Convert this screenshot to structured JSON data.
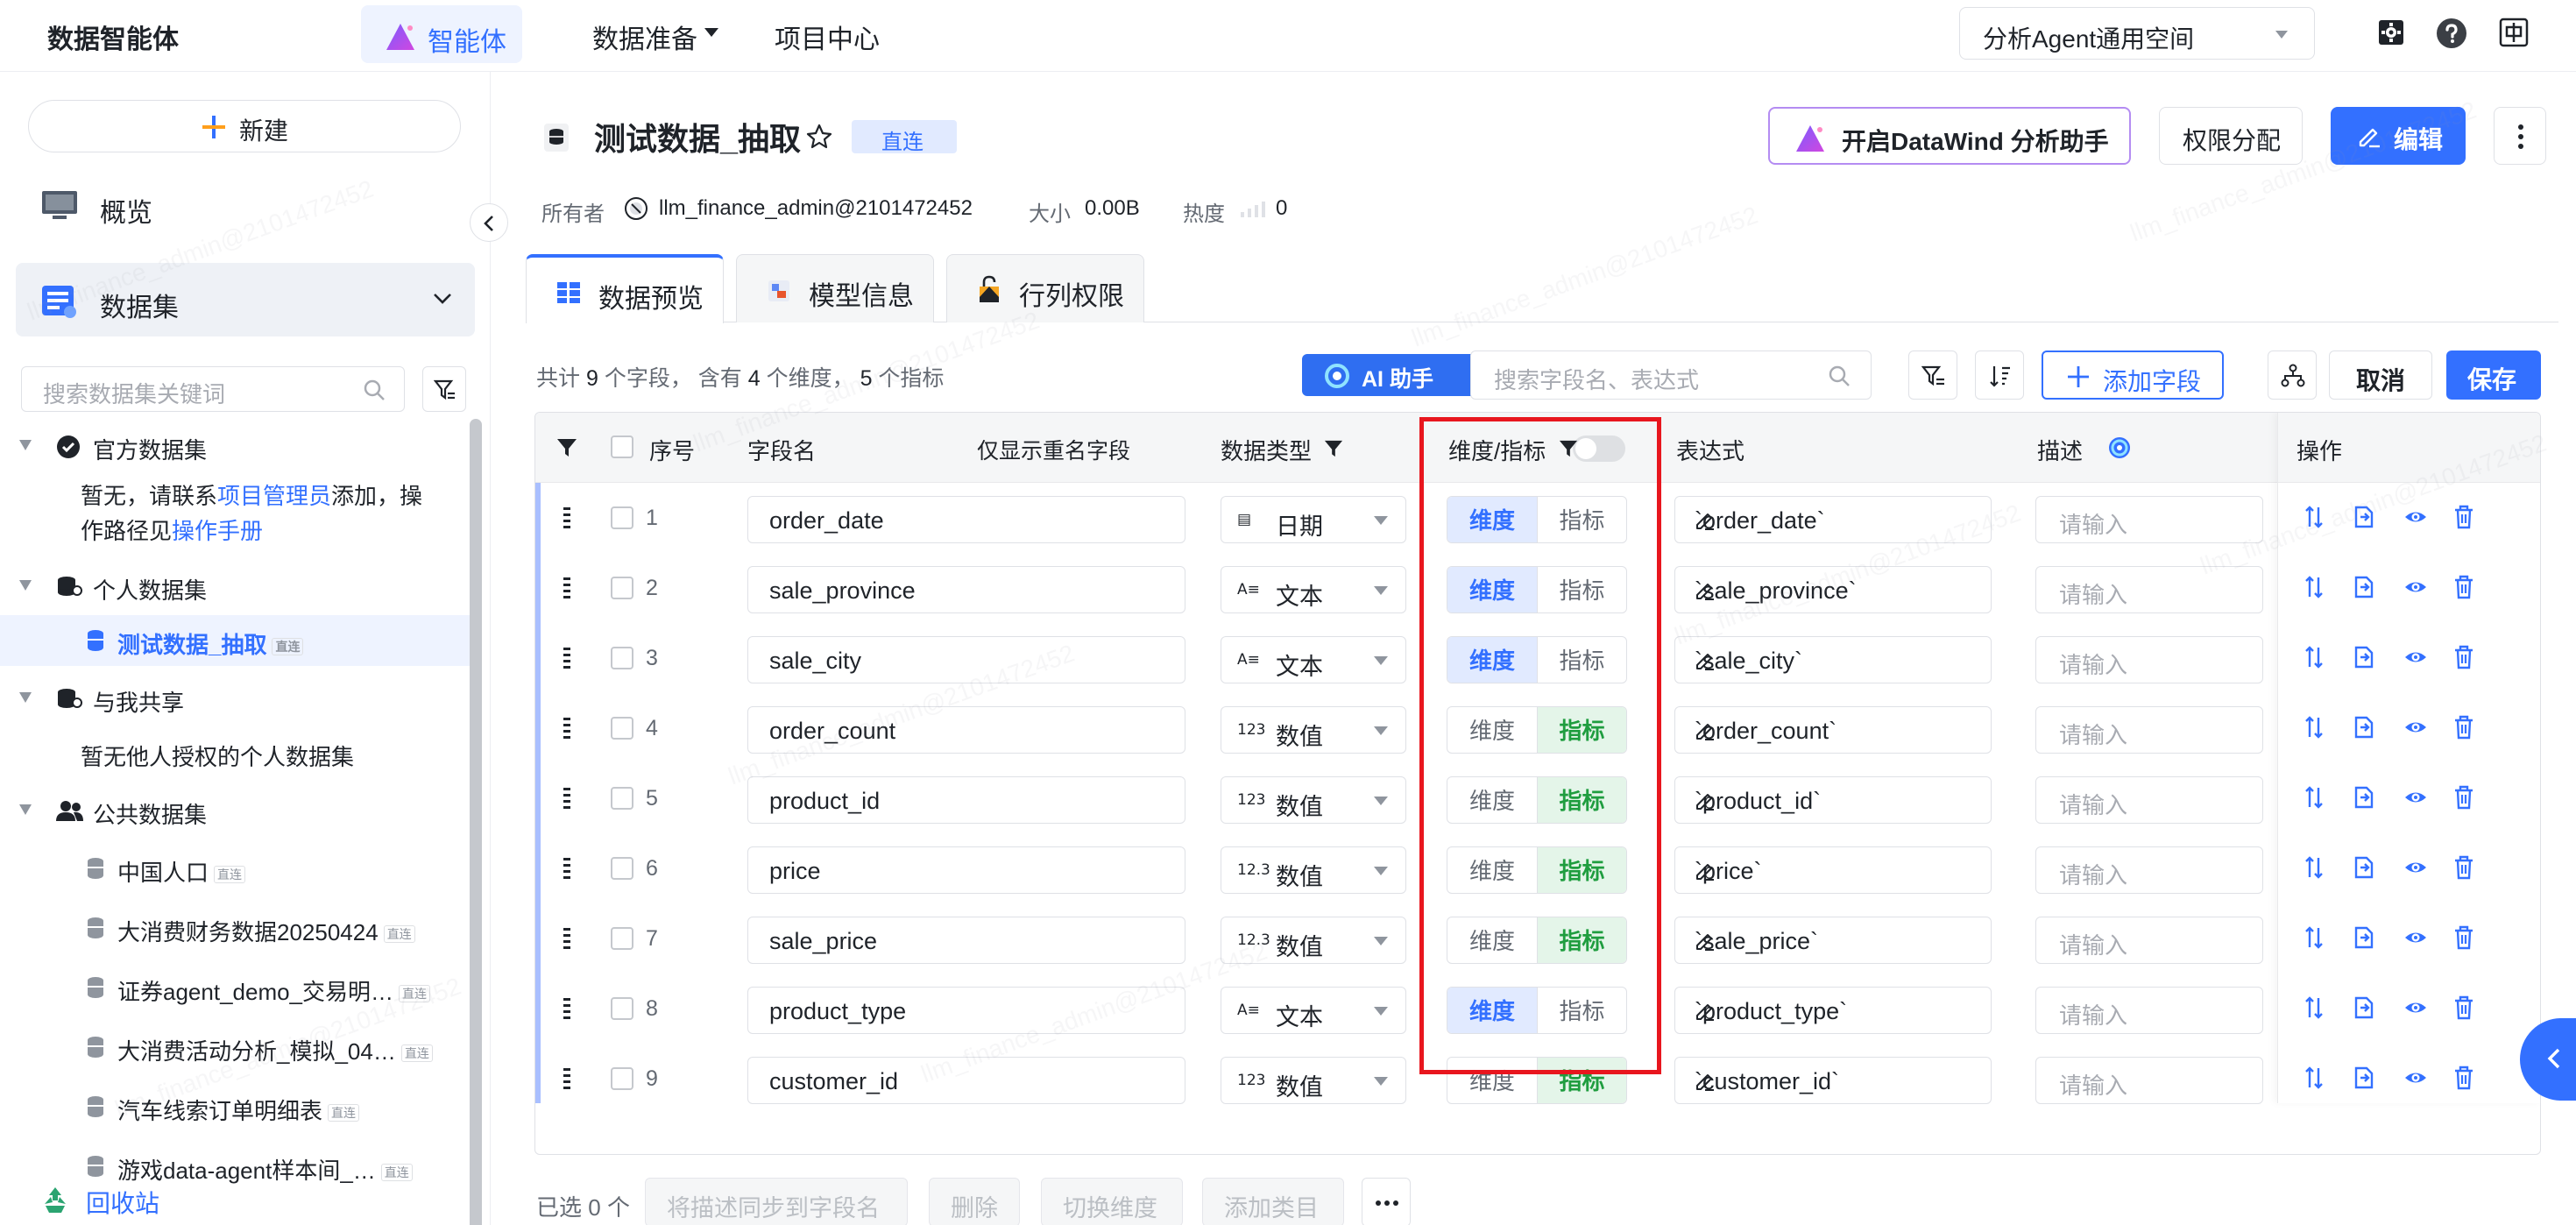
{
  "topnav": {
    "brand": "数据智能体",
    "agent": "智能体",
    "data_prep": "数据准备",
    "project_center": "项目中心",
    "space": "分析Agent通用空间"
  },
  "sidebar": {
    "new_label": "新建",
    "overview": "概览",
    "datasets": "数据集",
    "search_placeholder": "搜索数据集关键词",
    "official": "官方数据集",
    "official_hint_prefix": "暂无，请联系",
    "official_hint_link1": "项目管理员",
    "official_hint_mid": "添加，操",
    "official_hint_line2_prefix": "作路径见",
    "official_hint_link2": "操作手册",
    "personal": "个人数据集",
    "personal_items": [
      {
        "label": "测试数据_抽取",
        "tag": "直连"
      }
    ],
    "shared": "与我共享",
    "shared_empty": "暂无他人授权的个人数据集",
    "public": "公共数据集",
    "public_items": [
      {
        "label": "中国人口",
        "tag": "直连"
      },
      {
        "label": "大消费财务数据20250424",
        "tag": "直连"
      },
      {
        "label": "证券agent_demo_交易明…",
        "tag": "直连"
      },
      {
        "label": "大消费活动分析_模拟_04…",
        "tag": "直连"
      },
      {
        "label": "汽车线索订单明细表",
        "tag": "直连"
      },
      {
        "label": "游戏data-agent样本间_…",
        "tag": "直连"
      }
    ],
    "recycle": "回收站"
  },
  "header": {
    "title": "测试数据_抽取",
    "badge": "直连",
    "datawind": "开启DataWind 分析助手",
    "permissions": "权限分配",
    "edit": "编辑",
    "owner_label": "所有者",
    "owner": "llm_finance_admin@2101472452",
    "size_label": "大小",
    "size": "0.00B",
    "heat_label": "热度",
    "heat": "0"
  },
  "tabs": [
    {
      "label": "数据预览"
    },
    {
      "label": "模型信息"
    },
    {
      "label": "行列权限"
    }
  ],
  "toolbar": {
    "summary_a": "共计",
    "summary_fields": "9",
    "summary_b": "个字段， 含有",
    "summary_dims": "4",
    "summary_c": "个维度，",
    "summary_mets": "5",
    "summary_d": "个指标",
    "ai": "AI 助手",
    "search_placeholder": "搜索字段名、表达式",
    "add_field": "添加字段",
    "cancel": "取消",
    "save": "保存"
  },
  "table": {
    "headers": {
      "seq": "序号",
      "name": "字段名",
      "dup_only": "仅显示重名字段",
      "type": "数据类型",
      "role": "维度/指标",
      "expr": "表达式",
      "desc": "描述",
      "ops": "操作"
    },
    "role_dim": "维度",
    "role_met": "指标",
    "desc_placeholder": "请输入",
    "rows": [
      {
        "seq": "1",
        "name": "order_date",
        "type_icon": "▤",
        "type": "日期",
        "role": "dim",
        "expr": "`order_date`"
      },
      {
        "seq": "2",
        "name": "sale_province",
        "type_icon": "A≡",
        "type": "文本",
        "role": "dim",
        "expr": "`sale_province`"
      },
      {
        "seq": "3",
        "name": "sale_city",
        "type_icon": "A≡",
        "type": "文本",
        "role": "dim",
        "expr": "`sale_city`"
      },
      {
        "seq": "4",
        "name": "order_count",
        "type_icon": "123",
        "type": "数值",
        "role": "met",
        "expr": "`order_count`"
      },
      {
        "seq": "5",
        "name": "product_id",
        "type_icon": "123",
        "type": "数值",
        "role": "met",
        "expr": "`product_id`"
      },
      {
        "seq": "6",
        "name": "price",
        "type_icon": "12.3",
        "type": "数值",
        "role": "met",
        "expr": "`price`"
      },
      {
        "seq": "7",
        "name": "sale_price",
        "type_icon": "12.3",
        "type": "数值",
        "role": "met",
        "expr": "`sale_price`"
      },
      {
        "seq": "8",
        "name": "product_type",
        "type_icon": "A≡",
        "type": "文本",
        "role": "dim",
        "expr": "`product_type`"
      },
      {
        "seq": "9",
        "name": "customer_id",
        "type_icon": "123",
        "type": "数值",
        "role": "met",
        "expr": "`customer_id`"
      }
    ]
  },
  "bottom": {
    "selected_prefix": "已选",
    "selected_count": "0",
    "selected_suffix": "个",
    "sync_desc": "将描述同步到字段名",
    "delete": "删除",
    "switch_dim": "切换维度",
    "add_category": "添加类目"
  },
  "watermark": "llm_finance_admin@2101472452",
  "colors": {
    "primary": "#3370ff",
    "dim_bg": "#e1eaff",
    "metric_text": "#1f9d3f",
    "metric_bg": "#e4f5e9",
    "highlight": "#e8161e"
  }
}
